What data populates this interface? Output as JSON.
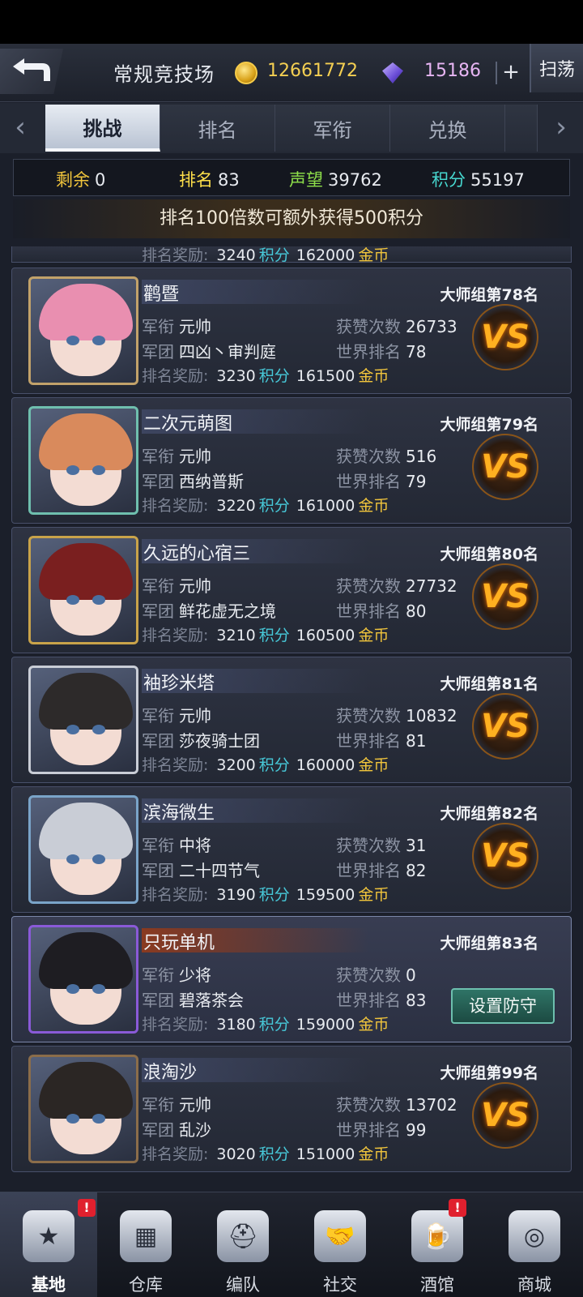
{
  "header": {
    "title": "常规竞技场",
    "gold": "12661772",
    "gems": "15186",
    "plus": "+",
    "sweep": "扫荡"
  },
  "tabs": [
    {
      "label": "挑战",
      "active": true
    },
    {
      "label": "排名"
    },
    {
      "label": "军衔"
    },
    {
      "label": "兑换"
    }
  ],
  "stats": {
    "remaining_label": "剩余",
    "remaining": "0",
    "rank_label": "排名",
    "rank": "83",
    "prestige_label": "声望",
    "prestige": "39762",
    "points_label": "积分",
    "points": "55197"
  },
  "notice": "排名100倍数可额外获得500积分",
  "labels": {
    "title": "军衔",
    "legion": "军团",
    "likes": "获赞次数",
    "world_rank": "世界排名",
    "reward": "排名奖励:",
    "points": "积分",
    "gold": "金币",
    "vs": "VS",
    "defend": "设置防守"
  },
  "partial_reward": {
    "points": "3240",
    "gold": "162000"
  },
  "players": [
    {
      "name": "鹳暨",
      "group_rank": "大师组第78名",
      "title": "元帅",
      "legion": "四凶丶审判庭",
      "likes": "26733",
      "world_rank": "78",
      "reward_points": "3230",
      "reward_gold": "161500",
      "self": false
    },
    {
      "name": "二次元萌图",
      "group_rank": "大师组第79名",
      "title": "元帅",
      "legion": "西纳普斯",
      "likes": "516",
      "world_rank": "79",
      "reward_points": "3220",
      "reward_gold": "161000",
      "self": false
    },
    {
      "name": "久远的心宿三",
      "group_rank": "大师组第80名",
      "title": "元帅",
      "legion": "鲜花虚无之境",
      "likes": "27732",
      "world_rank": "80",
      "reward_points": "3210",
      "reward_gold": "160500",
      "self": false
    },
    {
      "name": "袖珍米塔",
      "group_rank": "大师组第81名",
      "title": "元帅",
      "legion": "莎夜骑士团",
      "likes": "10832",
      "world_rank": "81",
      "reward_points": "3200",
      "reward_gold": "160000",
      "self": false
    },
    {
      "name": "滨海微生",
      "group_rank": "大师组第82名",
      "title": "中将",
      "legion": "二十四节气",
      "likes": "31",
      "world_rank": "82",
      "reward_points": "3190",
      "reward_gold": "159500",
      "self": false
    },
    {
      "name": "只玩单机",
      "group_rank": "大师组第83名",
      "title": "少将",
      "legion": "碧落茶会",
      "likes": "0",
      "world_rank": "83",
      "reward_points": "3180",
      "reward_gold": "159000",
      "self": true
    },
    {
      "name": "浪淘沙",
      "group_rank": "大师组第99名",
      "title": "元帅",
      "legion": "乱沙",
      "likes": "13702",
      "world_rank": "99",
      "reward_points": "3020",
      "reward_gold": "151000",
      "self": false
    }
  ],
  "nav": [
    {
      "label": "基地",
      "icon": "star-emblem-icon",
      "active": true,
      "badge": true
    },
    {
      "label": "仓库",
      "icon": "warehouse-icon"
    },
    {
      "label": "编队",
      "icon": "formation-helmet-icon"
    },
    {
      "label": "社交",
      "icon": "handshake-icon"
    },
    {
      "label": "酒馆",
      "icon": "tavern-icon",
      "badge": true
    },
    {
      "label": "商城",
      "icon": "shop-icon"
    }
  ],
  "badge_text": "!",
  "colors": {
    "gold": "#f0c43c",
    "points": "#47c8d8",
    "stat_remaining": "#f0c43c",
    "stat_rank": "#ffe04a",
    "stat_prestige": "#8ee04a",
    "stat_points": "#47d8d0"
  }
}
